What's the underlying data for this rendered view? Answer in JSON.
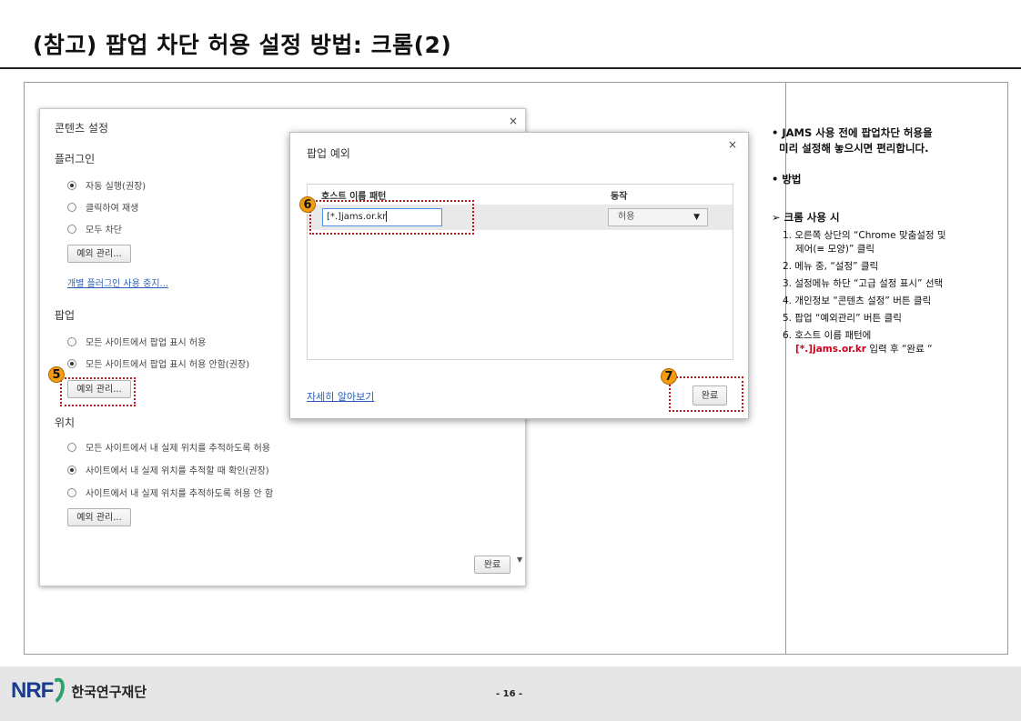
{
  "slide": {
    "title": "(참고) 팝업 차단 허용 설정 방법: 크롬(2)",
    "page_number": "- 16 -"
  },
  "content_settings": {
    "title": "콘텐츠 설정",
    "close": "×",
    "plugins_heading": "플러그인",
    "plugin_options": [
      "자동 실행(권장)",
      "클릭하여 재생",
      "모두 차단"
    ],
    "plugin_selected": 0,
    "manage_exceptions_label": "예외 관리...",
    "disable_plugins_link": "개별 플러그인 사용 중지...",
    "popups_heading": "팝업",
    "popup_options": [
      "모든 사이트에서 팝업 표시 허용",
      "모든 사이트에서 팝업 표시 허용 안함(권장)"
    ],
    "popup_selected": 1,
    "location_heading": "위치",
    "location_options": [
      "모든 사이트에서 내 실제 위치를 추적하도록 허용",
      "사이트에서 내 실제 위치를 추적할 때 확인(권장)",
      "사이트에서 내 실제 위치를 추적하도록 허용 안 함"
    ],
    "location_selected": 1,
    "done_label": "완료"
  },
  "popup_exceptions": {
    "title": "팝업 예외",
    "close": "×",
    "host_pattern_header": "호스트 이름 패턴",
    "action_header": "동작",
    "host_input_value": "[*.]jams.or.kr",
    "action_value": "허용",
    "learn_more_link": "자세히 알아보기",
    "done_label": "완료"
  },
  "badges": {
    "step5": "5",
    "step6": "6",
    "step7": "7"
  },
  "notes": {
    "intro_line1": "• JAMS 사용 전에 팝업차단 허용을",
    "intro_line2": "미리 설정해 놓으시면 편리합니다.",
    "method": "• 방법",
    "chrome_heading": "➢ 크롬 사용 시",
    "steps": [
      "1. 오른쪽 상단의 “Chrome 맞춤설정 및",
      "제어(≡ 모양)” 클릭",
      "2. 메뉴 중, “설정” 클릭",
      "3. 설정메뉴 하단 “고급 설정 표시” 선택",
      "4. 개인정보 “콘텐츠 설정” 버튼 클릭",
      "5. 팝업 “예외관리” 버튼 클릭",
      "6. 호스트 이름 패턴에"
    ],
    "step6_red": "[*.]jams.or.kr",
    "step6_rest": " 입력 후 “완료 “"
  },
  "footer": {
    "logo_text": "NRF",
    "org_name": "한국연구재단"
  },
  "colors": {
    "accent_red": "#d0021b",
    "badge_orange": "#f39c12",
    "link_blue": "#2b5fb5"
  }
}
